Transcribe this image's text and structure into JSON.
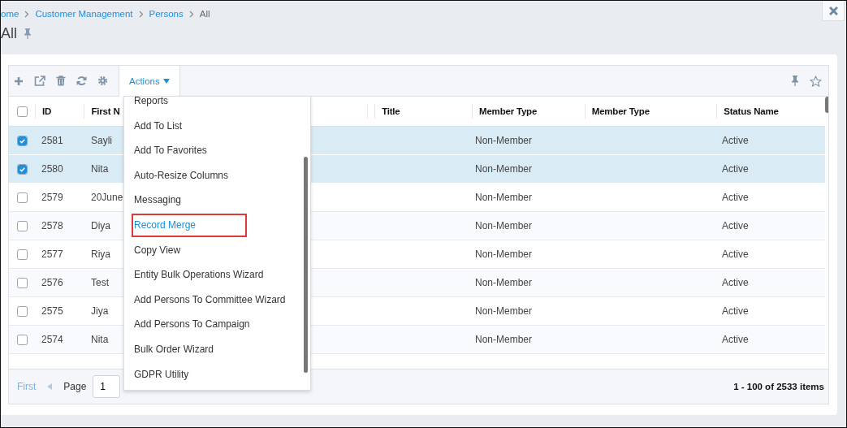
{
  "breadcrumb": [
    "ome",
    "Customer Management",
    "Persons",
    "All"
  ],
  "page_title": "All",
  "toolbar": {
    "actions_label": "Actions",
    "actions_open": true
  },
  "select_all_checked": false,
  "columns": [
    "ID",
    "First N",
    "",
    "Title",
    "Member Type",
    "Member Type",
    "Status Name"
  ],
  "rows": [
    {
      "id": "2581",
      "first_name": "Sayli",
      "member_type": "Non-Member",
      "status": "Active",
      "selected": true
    },
    {
      "id": "2580",
      "first_name": "Nita",
      "member_type": "Non-Member",
      "status": "Active",
      "selected": true
    },
    {
      "id": "2579",
      "first_name": "20June",
      "member_type": "Non-Member",
      "status": "Active",
      "selected": false
    },
    {
      "id": "2578",
      "first_name": "Diya",
      "member_type": "Non-Member",
      "status": "Active",
      "selected": false
    },
    {
      "id": "2577",
      "first_name": "Riya",
      "member_type": "Non-Member",
      "status": "Active",
      "selected": false
    },
    {
      "id": "2576",
      "first_name": "Test",
      "member_type": "Non-Member",
      "status": "Active",
      "selected": false
    },
    {
      "id": "2575",
      "first_name": "Jiya",
      "member_type": "Non-Member",
      "status": "Active",
      "selected": false
    },
    {
      "id": "2574",
      "first_name": "Nita",
      "member_type": "Non-Member",
      "status": "Active",
      "selected": false
    }
  ],
  "menu": [
    {
      "label": "Reports",
      "highlighted": false
    },
    {
      "label": "Add To List",
      "highlighted": false
    },
    {
      "label": "Add To Favorites",
      "highlighted": false
    },
    {
      "label": "Auto-Resize Columns",
      "highlighted": false
    },
    {
      "label": "Messaging",
      "highlighted": false
    },
    {
      "label": "Record Merge",
      "highlighted": true
    },
    {
      "label": "Copy View",
      "highlighted": false
    },
    {
      "label": "Entity Bulk Operations Wizard",
      "highlighted": false
    },
    {
      "label": "Add Persons To Committee Wizard",
      "highlighted": false
    },
    {
      "label": "Add Persons To Campaign",
      "highlighted": false
    },
    {
      "label": "Bulk Order Wizard",
      "highlighted": false
    },
    {
      "label": "GDPR Utility",
      "highlighted": false
    }
  ],
  "pager": {
    "first": "First",
    "first_disabled": true,
    "page_label": "Page",
    "page_value": "1",
    "summary": "1 - 100 of 2533 items"
  }
}
